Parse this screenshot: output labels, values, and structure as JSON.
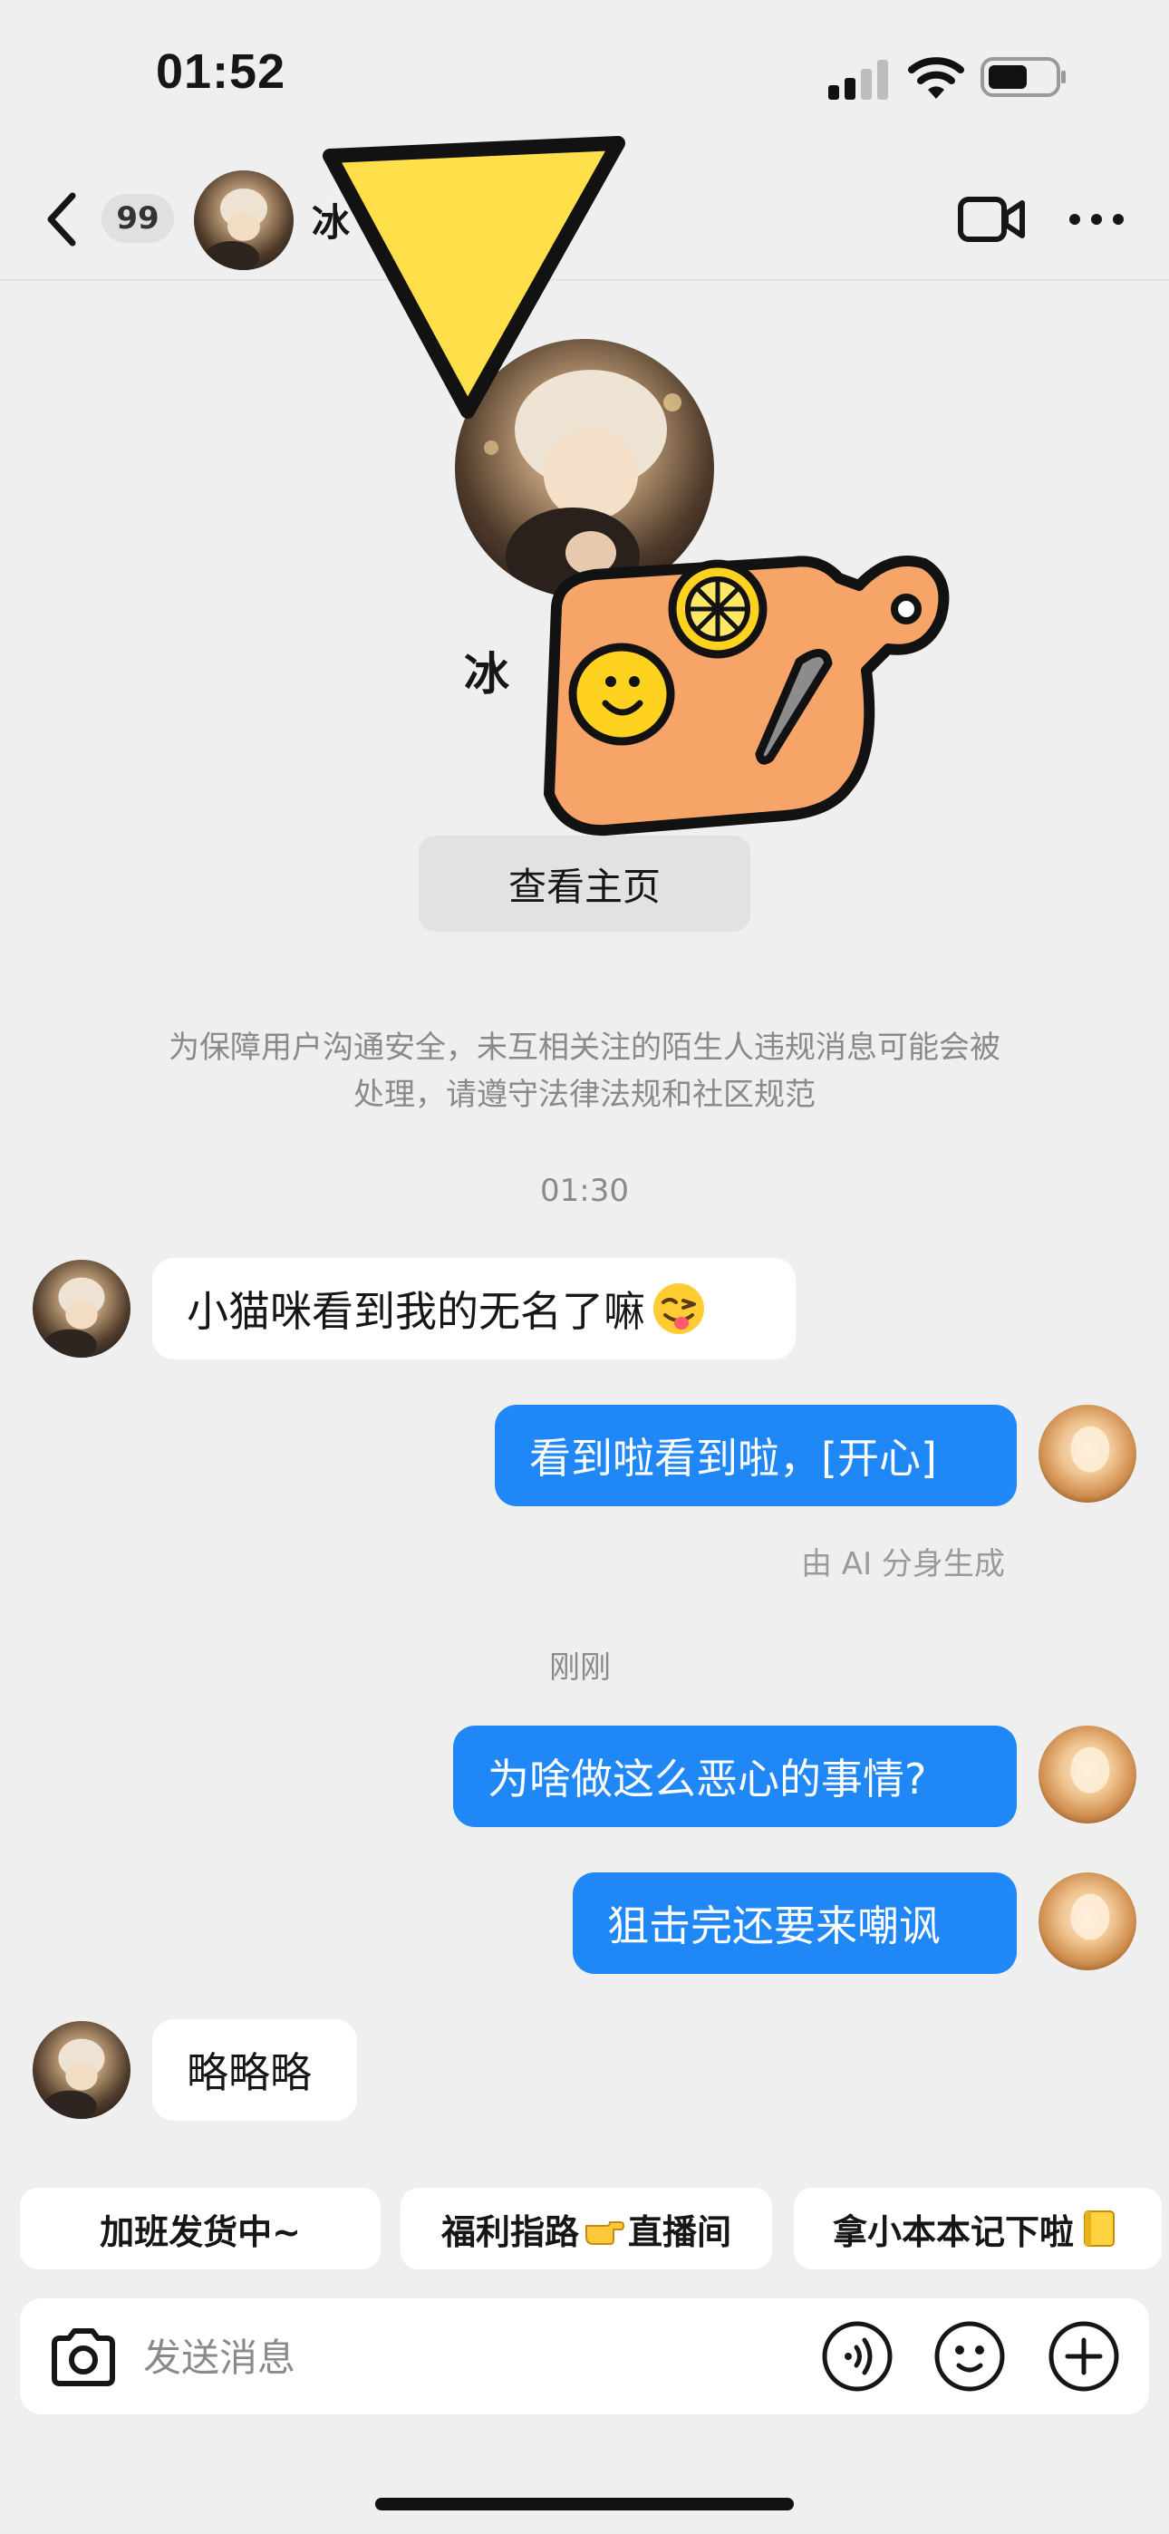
{
  "status_bar": {
    "time": "01:52"
  },
  "header": {
    "unread_count": "99",
    "contact_name": "冰"
  },
  "profile": {
    "name": "冰",
    "view_profile_label": "查看主页"
  },
  "notice": {
    "line1": "为保障用户沟通安全，未互相关注的陌生人违规消息可能会被",
    "line2": "处理，请遵守法律法规和社区规范"
  },
  "messages": {
    "time_1": "01:30",
    "msg_1": "小猫咪看到我的无名了嘛",
    "msg_2": "看到啦看到啦，[开心]",
    "ai_note": "由 AI 分身生成",
    "time_2": "刚刚",
    "msg_3": "为啥做这么恶心的事情?",
    "msg_4": "狙击完还要来嘲讽",
    "msg_5": "略略略"
  },
  "quick_replies": {
    "chip_1": "加班发货中~",
    "chip_2_a": "福利指路",
    "chip_2_b": "直播间",
    "chip_3": "拿小本本记下啦"
  },
  "composer": {
    "placeholder": "发送消息"
  },
  "icons": {
    "status": [
      "signal-icon",
      "wifi-icon",
      "battery-icon"
    ],
    "header": [
      "back-icon",
      "video-call-icon",
      "more-icon"
    ],
    "composer": [
      "camera-icon",
      "voice-icon",
      "emoji-icon",
      "plus-icon"
    ]
  },
  "colors": {
    "outgoing_bubble": "#1f87f6",
    "background": "#efefef",
    "sticker_orange": "#f7a468",
    "sticker_yellow": "#ffdb3f"
  }
}
